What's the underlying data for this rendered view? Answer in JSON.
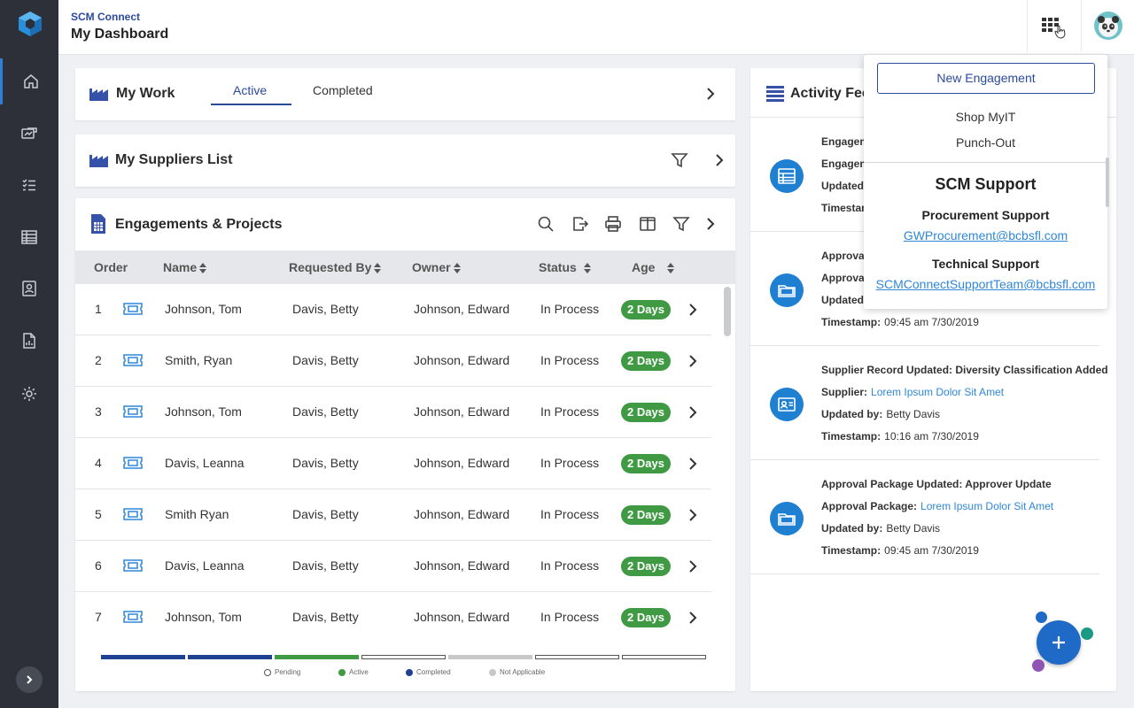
{
  "header": {
    "app_name": "SCM Connect",
    "page_title": "My Dashboard"
  },
  "sidebar": {
    "items": [
      {
        "icon": "home-icon"
      },
      {
        "icon": "engagement-icon"
      },
      {
        "icon": "task-list-icon"
      },
      {
        "icon": "table-icon"
      },
      {
        "icon": "contact-card-icon"
      },
      {
        "icon": "report-icon"
      },
      {
        "icon": "gear-icon"
      }
    ]
  },
  "my_work": {
    "title": "My Work",
    "tabs": [
      {
        "label": "Active"
      },
      {
        "label": "Completed"
      }
    ]
  },
  "suppliers": {
    "title": "My Suppliers List"
  },
  "engagements": {
    "title": "Engagements & Projects",
    "columns": [
      "Order",
      "Name",
      "Requested By",
      "Owner",
      "Status",
      "Age"
    ],
    "rows": [
      {
        "order": "1",
        "name": "Johnson, Tom",
        "requested_by": "Davis, Betty",
        "owner": "Johnson, Edward",
        "status": "In Process",
        "age": "2 Days"
      },
      {
        "order": "2",
        "name": "Smith, Ryan",
        "requested_by": "Davis, Betty",
        "owner": "Johnson, Edward",
        "status": "In Process",
        "age": "2 Days"
      },
      {
        "order": "3",
        "name": "Johnson, Tom",
        "requested_by": "Davis, Betty",
        "owner": "Johnson, Edward",
        "status": "In Process",
        "age": "2 Days"
      },
      {
        "order": "4",
        "name": "Davis, Leanna",
        "requested_by": "Davis, Betty",
        "owner": "Johnson, Edward",
        "status": "In Process",
        "age": "2 Days"
      },
      {
        "order": "5",
        "name": "Smith Ryan",
        "requested_by": "Davis, Betty",
        "owner": "Johnson, Edward",
        "status": "In Process",
        "age": "2 Days"
      },
      {
        "order": "6",
        "name": "Davis, Leanna",
        "requested_by": "Davis, Betty",
        "owner": "Johnson, Edward",
        "status": "In Process",
        "age": "2 Days"
      },
      {
        "order": "7",
        "name": "Johnson, Tom",
        "requested_by": "Davis, Betty",
        "owner": "Johnson, Edward",
        "status": "In Process",
        "age": "2 Days"
      }
    ],
    "progress_segments": [
      "Completed",
      "Completed",
      "Active",
      "Pending",
      "Not Applicable",
      "Pending",
      "Pending"
    ],
    "legend": [
      {
        "label": "Pending",
        "color": "#ffffff"
      },
      {
        "label": "Active",
        "color": "#3f9a43"
      },
      {
        "label": "Completed",
        "color": "#1e4192"
      },
      {
        "label": "Not Applicable",
        "color": "#c8c8c8"
      }
    ]
  },
  "activity_feed": {
    "title": "Activity Feed",
    "items": [
      {
        "icon": "table-icon",
        "lines": [
          {
            "label": "Engagem",
            "value": ""
          },
          {
            "label": "Engagem",
            "value": ""
          },
          {
            "label": "Updated",
            "value": ""
          },
          {
            "label": "Timestam",
            "value": ""
          }
        ]
      },
      {
        "icon": "folder-icon",
        "lines": [
          {
            "label": "Approval",
            "value": ""
          },
          {
            "label": "Approval",
            "value": ""
          },
          {
            "label": "Updated",
            "value": ""
          },
          {
            "label": "Timestamp:",
            "value": "09:45 am 7/30/2019"
          }
        ]
      },
      {
        "icon": "contact-card-icon",
        "title": "Supplier Record Updated: Diversity Classification Added",
        "lines": [
          {
            "label": "Supplier:",
            "value": "Lorem Ipsum Dolor Sit Amet",
            "link": true
          },
          {
            "label": "Updated by:",
            "value": "Betty Davis"
          },
          {
            "label": "Timestamp:",
            "value": "10:16 am 7/30/2019"
          }
        ]
      },
      {
        "icon": "folder-icon",
        "title": "Approval Package Updated: Approver Update",
        "lines": [
          {
            "label": "Approval Package:",
            "value": "Lorem Ipsum Dolor Sit Amet",
            "link": true
          },
          {
            "label": "Updated by:",
            "value": "Betty Davis"
          },
          {
            "label": "Timestamp:",
            "value": "09:45 am 7/30/2019"
          }
        ]
      }
    ]
  },
  "dropdown": {
    "new_engagement": "New Engagement",
    "links": [
      "Shop MyIT",
      "Punch-Out"
    ],
    "support_heading": "SCM Support",
    "procurement_label": "Procurement Support",
    "procurement_email": "GWProcurement@bcbsfl.com",
    "technical_label": "Technical Support",
    "technical_email": "SCMConnectSupportTeam@bcbsfl.com"
  },
  "colors": {
    "sidebar": "#2d3039",
    "brand_blue": "#2b4a9c",
    "status_green": "#3f9a43",
    "link_blue": "#2f87d8",
    "fab_blue": "#1f6ac6"
  }
}
